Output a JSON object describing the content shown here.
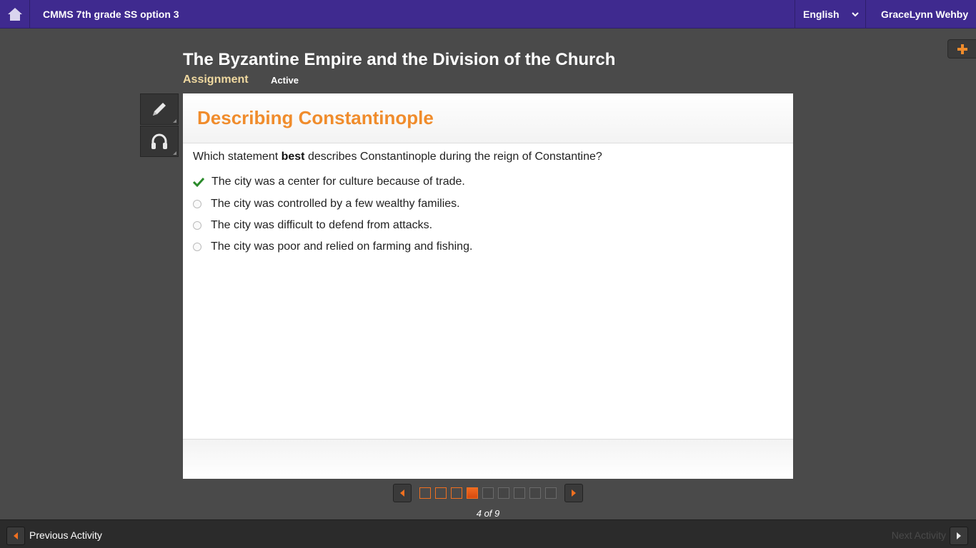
{
  "header": {
    "course_title": "CMMS 7th grade SS option 3",
    "language": "English",
    "user_name": "GraceLynn Wehby"
  },
  "lesson": {
    "title": "The Byzantine Empire and the Division of the Church",
    "type_label": "Assignment",
    "status": "Active"
  },
  "tools": [
    "pencil-icon",
    "headphones-icon"
  ],
  "activity": {
    "title": "Describing Constantinople",
    "question_pre": "Which statement ",
    "question_bold": "best",
    "question_post": " describes Constantinople during the reign of Constantine?",
    "options": [
      {
        "text": "The city was a center for culture because of trade.",
        "selected": true
      },
      {
        "text": "The city was controlled by a few wealthy families.",
        "selected": false
      },
      {
        "text": "The city was difficult to defend from attacks.",
        "selected": false
      },
      {
        "text": "The city was poor and relied on farming and fishing.",
        "selected": false
      }
    ]
  },
  "pager": {
    "current": 4,
    "total": 9,
    "label": "4 of 9"
  },
  "footer": {
    "previous_label": "Previous Activity",
    "next_label": "Next Activity"
  },
  "colors": {
    "topbar": "#3f2a8f",
    "accent": "#f08c2c",
    "check": "#2a8a2a"
  }
}
